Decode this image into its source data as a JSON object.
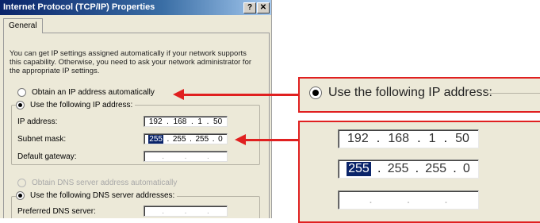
{
  "dialog": {
    "title": "Internet Protocol (TCP/IP) Properties",
    "help_button": "?",
    "close_button": "✕",
    "tab": "General",
    "description": "You can get IP settings assigned automatically if your network supports this capability. Otherwise, you need to ask your network administrator for the appropriate IP settings.",
    "radio_auto_ip": "Obtain an IP address automatically",
    "radio_manual_ip": "Use the following IP address:",
    "ip_address_label": "IP address:",
    "ip_address": [
      "192",
      "168",
      "1",
      "50"
    ],
    "subnet_label": "Subnet mask:",
    "subnet_mask": [
      "255",
      "255",
      "255",
      "0"
    ],
    "gateway_label": "Default gateway:",
    "gateway": [
      "",
      "",
      "",
      ""
    ],
    "radio_auto_dns": "Obtain DNS server address automatically",
    "radio_manual_dns": "Use the following DNS server addresses:",
    "preferred_dns_label": "Preferred DNS server:",
    "preferred_dns": [
      "",
      "",
      "",
      ""
    ]
  },
  "callout_top": {
    "radio_label": "Use the following IP address:"
  },
  "callout_bottom": {
    "ip_address": [
      "192",
      "168",
      "1",
      "50"
    ],
    "subnet_mask": [
      "255",
      "255",
      "255",
      "0"
    ],
    "gateway": [
      "",
      "",
      "",
      ""
    ]
  },
  "colors": {
    "arrow": "#e02020",
    "titlebar": "#0a246a",
    "selection": "#0a246a"
  }
}
